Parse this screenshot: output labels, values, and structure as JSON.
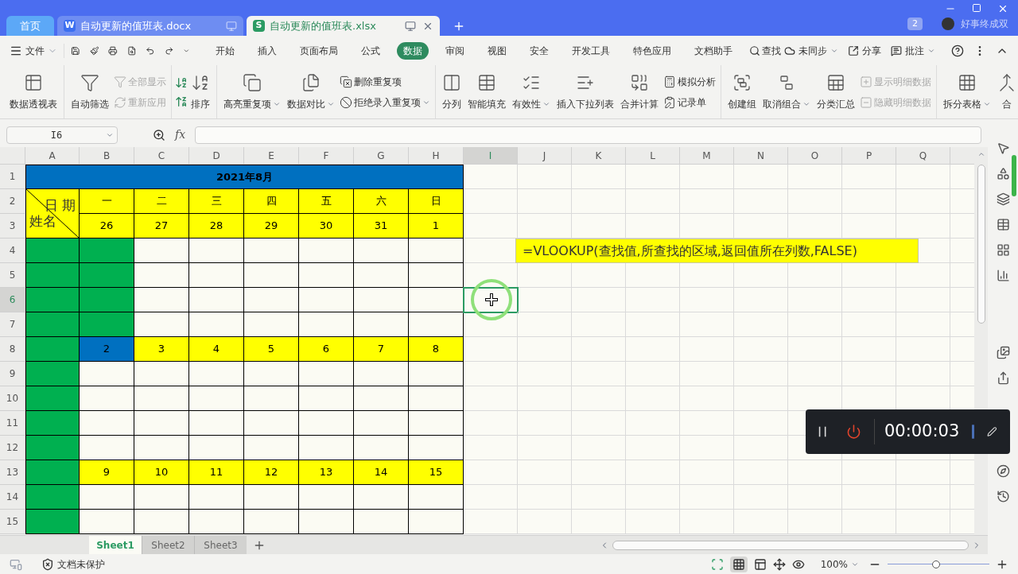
{
  "doc_tabs": [
    {
      "kind": "home",
      "label": "首页",
      "selected": false
    },
    {
      "kind": "writer",
      "badge": "W",
      "label": "自动更新的值班表.docx",
      "selected": false
    },
    {
      "kind": "sheet",
      "badge": "S",
      "label": "自动更新的值班表.xlsx",
      "selected": true
    }
  ],
  "notifications": "2",
  "user": "好事终成双",
  "file_menu": "文件",
  "menu_tabs": [
    {
      "label": "开始",
      "selected": false
    },
    {
      "label": "插入",
      "selected": false
    },
    {
      "label": "页面布局",
      "selected": false
    },
    {
      "label": "公式",
      "selected": false
    },
    {
      "label": "数据",
      "selected": true
    },
    {
      "label": "审阅",
      "selected": false
    },
    {
      "label": "视图",
      "selected": false
    },
    {
      "label": "安全",
      "selected": false
    },
    {
      "label": "开发工具",
      "selected": false
    },
    {
      "label": "特色应用",
      "selected": false
    },
    {
      "label": "文档助手",
      "selected": false
    }
  ],
  "search": "查找",
  "menu_actions": [
    {
      "label": "未同步",
      "dropdown": true
    },
    {
      "label": "分享",
      "dropdown": false
    },
    {
      "label": "批注",
      "dropdown": true
    }
  ],
  "ribbon": [
    {
      "items": [
        {
          "kind": "large",
          "label": "数据透视表",
          "dropdown": false
        }
      ]
    },
    {
      "items": [
        {
          "kind": "large",
          "label": "自动筛选",
          "dropdown": false
        },
        {
          "kind": "stack",
          "items": [
            {
              "label": "全部显示",
              "disabled": true,
              "dropdown": false
            },
            {
              "label": "重新应用",
              "disabled": true,
              "dropdown": false
            }
          ]
        }
      ]
    },
    {
      "items": [
        {
          "kind": "sort"
        },
        {
          "kind": "large",
          "label": "排序",
          "dropdown": false
        }
      ]
    },
    {
      "items": [
        {
          "kind": "large",
          "label": "高亮重复项",
          "dropdown": true
        },
        {
          "kind": "large",
          "label": "数据对比",
          "dropdown": true
        },
        {
          "kind": "stack",
          "items": [
            {
              "label": "删除重复项",
              "disabled": false,
              "dropdown": false
            },
            {
              "label": "拒绝录入重复项",
              "disabled": false,
              "dropdown": true
            }
          ]
        }
      ]
    },
    {
      "items": [
        {
          "kind": "large",
          "label": "分列",
          "dropdown": false
        },
        {
          "kind": "large",
          "label": "智能填充",
          "dropdown": false
        },
        {
          "kind": "large",
          "label": "有效性",
          "dropdown": true
        },
        {
          "kind": "large",
          "label": "插入下拉列表",
          "dropdown": false
        },
        {
          "kind": "large",
          "label": "合并计算",
          "dropdown": false
        },
        {
          "kind": "stack",
          "items": [
            {
              "label": "模拟分析",
              "disabled": false,
              "dropdown": false
            },
            {
              "label": "记录单",
              "disabled": false,
              "dropdown": false
            }
          ]
        }
      ]
    },
    {
      "items": [
        {
          "kind": "large",
          "label": "创建组",
          "dropdown": false
        },
        {
          "kind": "large",
          "label": "取消组合",
          "dropdown": true
        },
        {
          "kind": "large",
          "label": "分类汇总",
          "dropdown": false
        },
        {
          "kind": "stack",
          "items": [
            {
              "label": "显示明细数据",
              "disabled": true,
              "dropdown": false
            },
            {
              "label": "隐藏明细数据",
              "disabled": true,
              "dropdown": false
            }
          ]
        }
      ]
    },
    {
      "items": [
        {
          "kind": "large",
          "label": "拆分表格",
          "dropdown": true
        },
        {
          "kind": "large",
          "label": "合",
          "dropdown": false
        }
      ]
    }
  ],
  "name_box": "I6",
  "function_label": "fx",
  "columns": [
    {
      "label": "A",
      "selected": false
    },
    {
      "label": "B",
      "selected": false
    },
    {
      "label": "C",
      "selected": false
    },
    {
      "label": "D",
      "selected": false
    },
    {
      "label": "E",
      "selected": false
    },
    {
      "label": "F",
      "selected": false
    },
    {
      "label": "G",
      "selected": false
    },
    {
      "label": "H",
      "selected": false
    },
    {
      "label": "I",
      "selected": true
    },
    {
      "label": "J",
      "selected": false
    },
    {
      "label": "K",
      "selected": false
    },
    {
      "label": "L",
      "selected": false
    },
    {
      "label": "M",
      "selected": false
    },
    {
      "label": "N",
      "selected": false
    },
    {
      "label": "O",
      "selected": false
    },
    {
      "label": "P",
      "selected": false
    },
    {
      "label": "Q",
      "selected": false
    }
  ],
  "rows": [
    {
      "header": "1",
      "selected": false,
      "cells": [
        {
          "kind": "title",
          "text": "2021年8月"
        }
      ]
    },
    {
      "header": "2",
      "selected": false,
      "cells": [
        {
          "kind": "diagonal",
          "top": "日 期",
          "bottom": "姓名"
        },
        {
          "kind": "date",
          "text": "一"
        },
        {
          "kind": "date",
          "text": "二"
        },
        {
          "kind": "date",
          "text": "三"
        },
        {
          "kind": "date",
          "text": "四"
        },
        {
          "kind": "date",
          "text": "五"
        },
        {
          "kind": "date",
          "text": "六"
        },
        {
          "kind": "date",
          "text": "日"
        }
      ]
    },
    {
      "header": "3",
      "selected": false,
      "cells": [
        {
          "kind": "date",
          "text": "26"
        },
        {
          "kind": "date",
          "text": "27"
        },
        {
          "kind": "date",
          "text": "28"
        },
        {
          "kind": "date",
          "text": "29"
        },
        {
          "kind": "date",
          "text": "30"
        },
        {
          "kind": "date",
          "text": "31"
        },
        {
          "kind": "date",
          "text": "1"
        }
      ]
    },
    {
      "header": "4",
      "selected": false,
      "cells": [
        {
          "kind": "name"
        },
        {
          "kind": "name"
        },
        {
          "kind": "blank"
        },
        {
          "kind": "blank"
        },
        {
          "kind": "blank"
        },
        {
          "kind": "blank"
        },
        {
          "kind": "blank"
        },
        {
          "kind": "blank"
        }
      ]
    },
    {
      "header": "5",
      "selected": false,
      "cells": [
        {
          "kind": "name"
        },
        {
          "kind": "name"
        },
        {
          "kind": "blank"
        },
        {
          "kind": "blank"
        },
        {
          "kind": "blank"
        },
        {
          "kind": "blank"
        },
        {
          "kind": "blank"
        },
        {
          "kind": "blank"
        }
      ]
    },
    {
      "header": "6",
      "selected": true,
      "cells": [
        {
          "kind": "name"
        },
        {
          "kind": "name"
        },
        {
          "kind": "blank"
        },
        {
          "kind": "blank"
        },
        {
          "kind": "blank"
        },
        {
          "kind": "blank"
        },
        {
          "kind": "blank"
        },
        {
          "kind": "blank"
        }
      ]
    },
    {
      "header": "7",
      "selected": false,
      "cells": [
        {
          "kind": "name"
        },
        {
          "kind": "name"
        },
        {
          "kind": "blank"
        },
        {
          "kind": "blank"
        },
        {
          "kind": "blank"
        },
        {
          "kind": "blank"
        },
        {
          "kind": "blank"
        },
        {
          "kind": "blank"
        }
      ]
    },
    {
      "header": "8",
      "selected": false,
      "cells": [
        {
          "kind": "name"
        },
        {
          "kind": "highlight",
          "text": "2"
        },
        {
          "kind": "date",
          "text": "3"
        },
        {
          "kind": "date",
          "text": "4"
        },
        {
          "kind": "date",
          "text": "5"
        },
        {
          "kind": "date",
          "text": "6"
        },
        {
          "kind": "date",
          "text": "7"
        },
        {
          "kind": "date",
          "text": "8"
        }
      ]
    },
    {
      "header": "9",
      "selected": false,
      "cells": [
        {
          "kind": "name"
        },
        {
          "kind": "blank"
        },
        {
          "kind": "blank"
        },
        {
          "kind": "blank"
        },
        {
          "kind": "blank"
        },
        {
          "kind": "blank"
        },
        {
          "kind": "blank"
        },
        {
          "kind": "blank"
        }
      ]
    },
    {
      "header": "10",
      "selected": false,
      "cells": [
        {
          "kind": "name"
        },
        {
          "kind": "blank"
        },
        {
          "kind": "blank"
        },
        {
          "kind": "blank"
        },
        {
          "kind": "blank"
        },
        {
          "kind": "blank"
        },
        {
          "kind": "blank"
        },
        {
          "kind": "blank"
        }
      ]
    },
    {
      "header": "11",
      "selected": false,
      "cells": [
        {
          "kind": "name"
        },
        {
          "kind": "blank"
        },
        {
          "kind": "blank"
        },
        {
          "kind": "blank"
        },
        {
          "kind": "blank"
        },
        {
          "kind": "blank"
        },
        {
          "kind": "blank"
        },
        {
          "kind": "blank"
        }
      ]
    },
    {
      "header": "12",
      "selected": false,
      "cells": [
        {
          "kind": "name"
        },
        {
          "kind": "blank"
        },
        {
          "kind": "blank"
        },
        {
          "kind": "blank"
        },
        {
          "kind": "blank"
        },
        {
          "kind": "blank"
        },
        {
          "kind": "blank"
        },
        {
          "kind": "blank"
        }
      ]
    },
    {
      "header": "13",
      "selected": false,
      "cells": [
        {
          "kind": "name"
        },
        {
          "kind": "date",
          "text": "9"
        },
        {
          "kind": "date",
          "text": "10"
        },
        {
          "kind": "date",
          "text": "11"
        },
        {
          "kind": "date",
          "text": "12"
        },
        {
          "kind": "date",
          "text": "13"
        },
        {
          "kind": "date",
          "text": "14"
        },
        {
          "kind": "date",
          "text": "15"
        }
      ]
    },
    {
      "header": "14",
      "selected": false,
      "cells": [
        {
          "kind": "name"
        },
        {
          "kind": "blank"
        },
        {
          "kind": "blank"
        },
        {
          "kind": "blank"
        },
        {
          "kind": "blank"
        },
        {
          "kind": "blank"
        },
        {
          "kind": "blank"
        },
        {
          "kind": "blank"
        }
      ]
    },
    {
      "header": "15",
      "selected": false,
      "cells": [
        {
          "kind": "name"
        },
        {
          "kind": "blank"
        },
        {
          "kind": "blank"
        },
        {
          "kind": "blank"
        },
        {
          "kind": "blank"
        },
        {
          "kind": "blank"
        },
        {
          "kind": "blank"
        },
        {
          "kind": "blank"
        }
      ]
    }
  ],
  "formula_note": "=VLOOKUP(查找值,所查找的区域,返回值所在列数,FALSE)",
  "recorder": {
    "time": "00:00:03"
  },
  "sheets": [
    {
      "label": "Sheet1",
      "selected": true
    },
    {
      "label": "Sheet2",
      "selected": false
    },
    {
      "label": "Sheet3",
      "selected": false
    }
  ],
  "status": {
    "protection": "文档未保护",
    "zoom": "100%",
    "zoom_slider": {
      "level": 0.48
    }
  }
}
